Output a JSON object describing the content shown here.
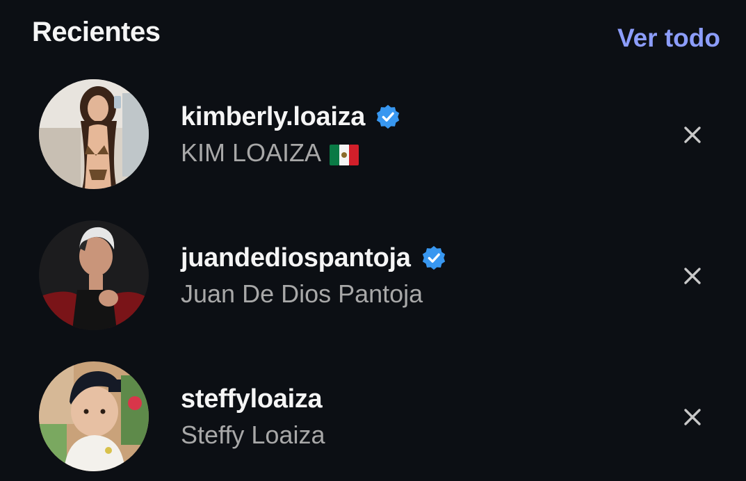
{
  "header": {
    "title": "Recientes",
    "see_all": "Ver todo"
  },
  "recents": [
    {
      "username": "kimberly.loaiza",
      "verified": true,
      "full_name": "KIM LOAIZA",
      "flag": "mexico-flag-icon"
    },
    {
      "username": "juandediospantoja",
      "verified": true,
      "full_name": "Juan De Dios Pantoja"
    },
    {
      "username": "steffyloaiza",
      "verified": false,
      "full_name": "Steffy Loaiza"
    }
  ],
  "icons": {
    "verified": "verified-badge-icon",
    "remove": "close-icon"
  },
  "colors": {
    "background": "#0c0f14",
    "link": "#8c9dfb",
    "verified": "#3897f0",
    "secondary_text": "#a8a8a8"
  }
}
